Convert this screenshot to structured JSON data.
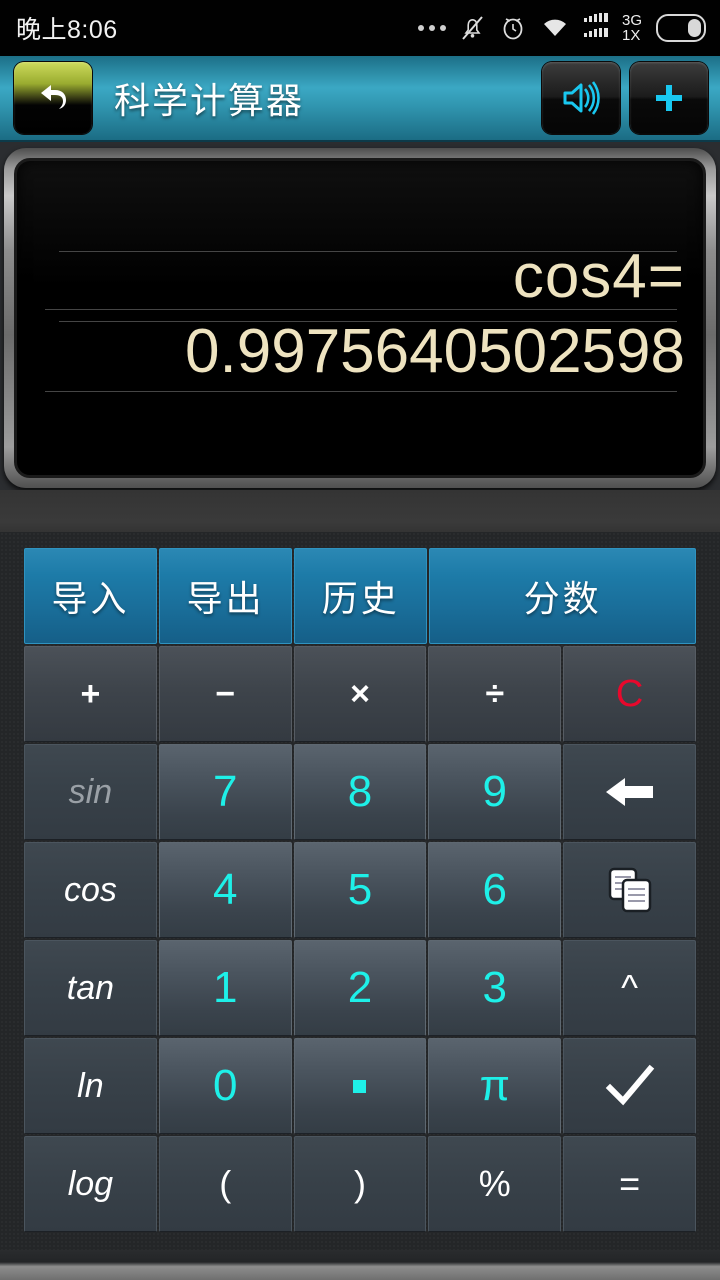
{
  "statusbar": {
    "time": "晚上8:06",
    "icons": [
      "more-dots-icon",
      "mute-bell-icon",
      "alarm-clock-icon",
      "wifi-icon",
      "signal-bars-icon",
      "battery-icon"
    ],
    "network_primary": "3G",
    "network_secondary": "1X"
  },
  "titlebar": {
    "back_icon": "back-arrow-icon",
    "title": "科学计算器",
    "speaker_icon": "speaker-icon",
    "add_icon": "plus-icon"
  },
  "display": {
    "expression": "cos4=",
    "result": "0.9975640502598"
  },
  "keypad": {
    "rows": [
      [
        {
          "label": "导入",
          "style": "blue",
          "name": "import-button"
        },
        {
          "label": "导出",
          "style": "blue",
          "name": "export-button"
        },
        {
          "label": "历史",
          "style": "blue",
          "name": "history-button"
        },
        {
          "label": "分数",
          "style": "blue",
          "name": "fraction-button",
          "wide": true
        }
      ],
      [
        {
          "label": "+",
          "style": "op",
          "name": "plus-key"
        },
        {
          "label": "−",
          "style": "op",
          "name": "minus-key"
        },
        {
          "label": "×",
          "style": "op",
          "name": "multiply-key"
        },
        {
          "label": "÷",
          "style": "op",
          "name": "divide-key"
        },
        {
          "label": "C",
          "style": "op red",
          "name": "clear-key"
        }
      ],
      [
        {
          "label": "sin",
          "style": "fn dim",
          "name": "sin-key"
        },
        {
          "label": "7",
          "style": "num",
          "name": "digit-7-key"
        },
        {
          "label": "8",
          "style": "num",
          "name": "digit-8-key"
        },
        {
          "label": "9",
          "style": "num",
          "name": "digit-9-key"
        },
        {
          "label": "",
          "style": "act",
          "name": "backspace-key",
          "icon": "backspace-arrow-icon"
        }
      ],
      [
        {
          "label": "cos",
          "style": "fn",
          "name": "cos-key"
        },
        {
          "label": "4",
          "style": "num",
          "name": "digit-4-key"
        },
        {
          "label": "5",
          "style": "num",
          "name": "digit-5-key"
        },
        {
          "label": "6",
          "style": "num",
          "name": "digit-6-key"
        },
        {
          "label": "",
          "style": "act",
          "name": "copy-key",
          "icon": "copy-documents-icon"
        }
      ],
      [
        {
          "label": "tan",
          "style": "fn",
          "name": "tan-key"
        },
        {
          "label": "1",
          "style": "num",
          "name": "digit-1-key"
        },
        {
          "label": "2",
          "style": "num",
          "name": "digit-2-key"
        },
        {
          "label": "3",
          "style": "num",
          "name": "digit-3-key"
        },
        {
          "label": "^",
          "style": "act",
          "name": "power-key"
        }
      ],
      [
        {
          "label": "ln",
          "style": "fn",
          "name": "ln-key"
        },
        {
          "label": "0",
          "style": "num",
          "name": "digit-0-key"
        },
        {
          "label": "",
          "style": "num",
          "name": "decimal-point-key",
          "icon": "decimal-dot-icon"
        },
        {
          "label": "π",
          "style": "num cy",
          "name": "pi-key"
        },
        {
          "label": "",
          "style": "act",
          "name": "sqrt-confirm-key",
          "icon": "check-mark-icon"
        }
      ],
      [
        {
          "label": "log",
          "style": "fn",
          "name": "log-key"
        },
        {
          "label": "(",
          "style": "act",
          "name": "left-paren-key"
        },
        {
          "label": ")",
          "style": "act",
          "name": "right-paren-key"
        },
        {
          "label": "%",
          "style": "act",
          "name": "percent-key"
        },
        {
          "label": "=",
          "style": "act",
          "name": "equals-key"
        }
      ]
    ]
  },
  "colors": {
    "accent_blue": "#1d7ba8",
    "digit_cyan": "#1ef0e8",
    "clear_red": "#e8082c",
    "lcd_text": "#eee3c0",
    "titlebar_teal": "#3ba8c4"
  }
}
